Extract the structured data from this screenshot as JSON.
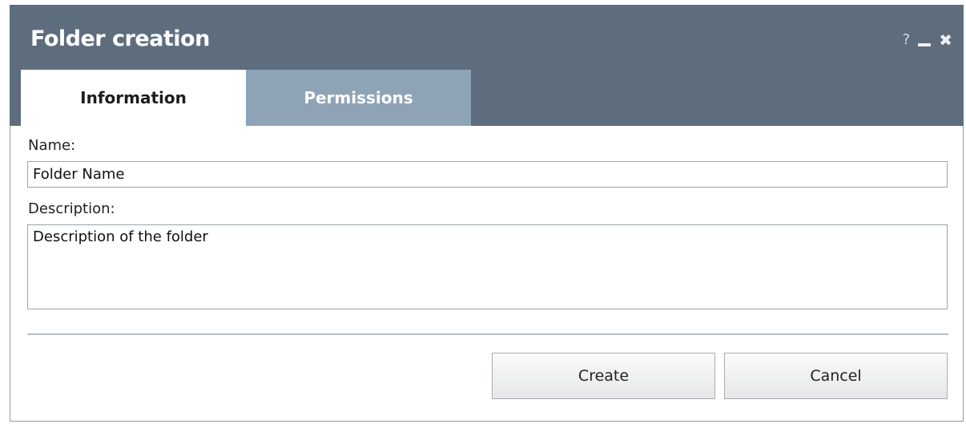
{
  "dialog": {
    "title": "Folder creation",
    "controls": {
      "help": "?",
      "minimize": "minimize-icon",
      "close": "✖"
    }
  },
  "tabs": [
    {
      "label": "Information",
      "active": true
    },
    {
      "label": "Permissions",
      "active": false
    }
  ],
  "form": {
    "name_label": "Name:",
    "name_value": "Folder Name",
    "description_label": "Description:",
    "description_value": "Description of the folder"
  },
  "buttons": {
    "create": "Create",
    "cancel": "Cancel"
  },
  "colors": {
    "titlebar": "#5d6d7e",
    "inactive_tab": "#8fa3b7"
  }
}
